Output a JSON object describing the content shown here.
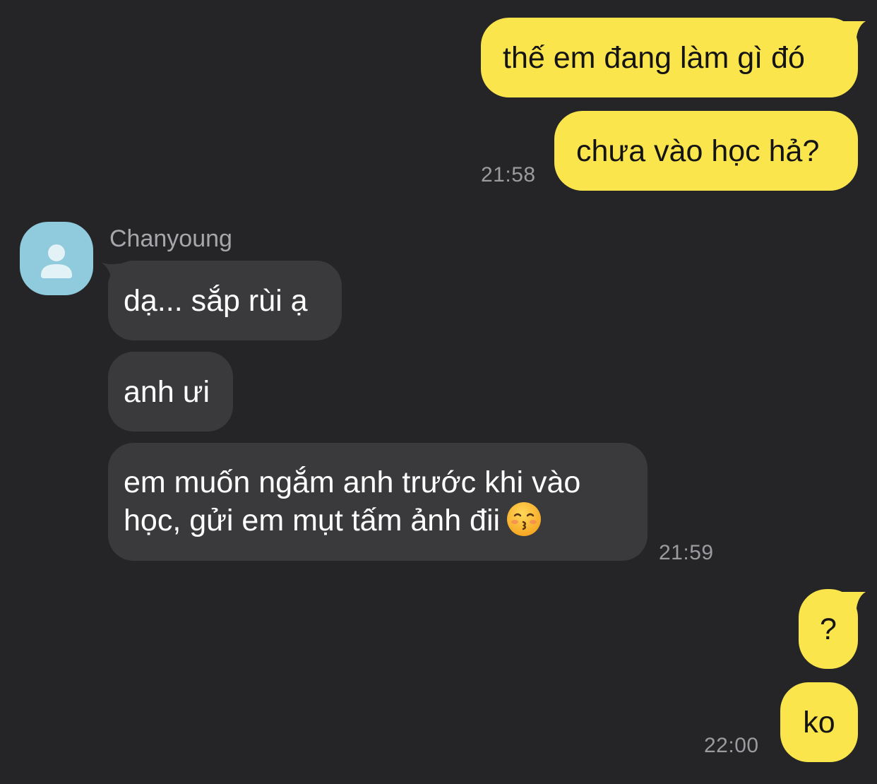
{
  "conversation": {
    "contact_name": "Chanyoung",
    "messages": [
      {
        "id": "m1",
        "direction": "outgoing",
        "text": "thế em đang làm gì đó"
      },
      {
        "id": "m2",
        "direction": "outgoing",
        "text": "chưa vào học hả?",
        "time": "21:58"
      },
      {
        "id": "m3",
        "direction": "incoming",
        "text": "dạ... sắp rùi ạ"
      },
      {
        "id": "m4",
        "direction": "incoming",
        "text": "anh ưi"
      },
      {
        "id": "m5",
        "direction": "incoming",
        "line1": "em muốn ngắm anh trước khi vào",
        "line2": "học, gửi em mụt tấm ảnh đii",
        "emoji": "kissing-face-with-closed-eyes",
        "time": "21:59"
      },
      {
        "id": "m6",
        "direction": "outgoing",
        "text": "?"
      },
      {
        "id": "m7",
        "direction": "outgoing",
        "text": "ko",
        "time": "22:00"
      }
    ]
  },
  "colors": {
    "background": "#252527",
    "outgoing_bubble": "#fbe54d",
    "incoming_bubble": "#3a3a3c",
    "avatar": "#8fcbdc",
    "timestamp": "#9b9b9f"
  }
}
